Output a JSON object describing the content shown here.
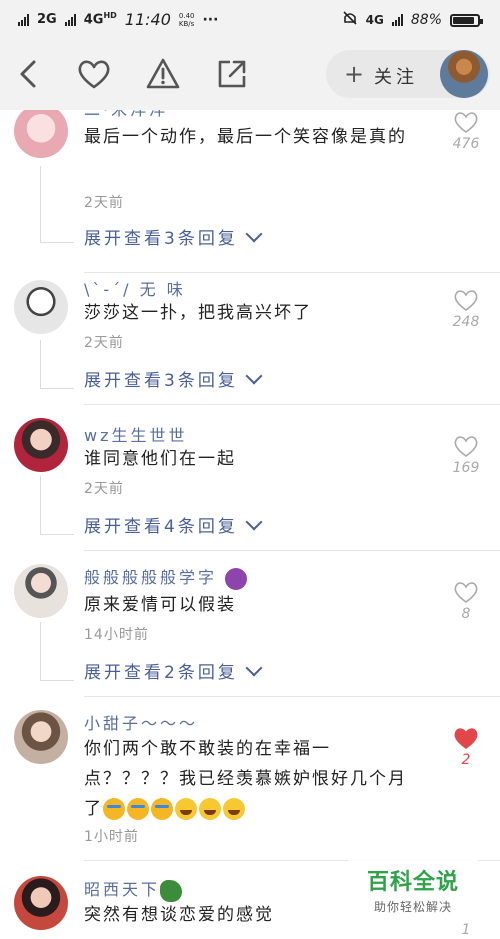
{
  "status_bar": {
    "network_1": "2G",
    "network_2": "4G",
    "network_2_sup": "HD",
    "time": "11:40",
    "speed_value": "0.40",
    "speed_unit": "KB/s",
    "more": "···",
    "right_network": "4G",
    "battery_text": "88%",
    "battery_level": 0.88
  },
  "toolbar": {
    "follow_label": "关注"
  },
  "comments": [
    {
      "name": "二·米洋洋",
      "text": "最后一个动作，最后一个笑容像是真的",
      "time": "2天前",
      "expand": "展开查看3条回复",
      "likes": "476",
      "liked": false,
      "avatar_color": "#f2c4c9"
    },
    {
      "name": "\\ˋ-´/ 无 味",
      "text": "莎莎这一扑，把我高兴坏了",
      "time": "2天前",
      "expand": "展开查看3条回复",
      "likes": "248",
      "liked": false,
      "avatar_color": "#bdbdbd"
    },
    {
      "name": "wz生生世世",
      "text": "谁同意他们在一起",
      "time": "2天前",
      "expand": "展开查看4条回复",
      "likes": "169",
      "liked": false,
      "avatar_color": "#a0253b"
    },
    {
      "name": "般般般般般学字",
      "text": "原来爱情可以假装",
      "time": "14小时前",
      "expand": "展开查看2条回复",
      "likes": "8",
      "liked": false,
      "avatar_color": "#d9d3cf"
    },
    {
      "name": "小甜子～～～",
      "text": "你们两个敢不敢装的在幸福一点？？？？我已经羡慕嫉妒恨好几个月了",
      "time": "1小时前",
      "expand": "",
      "likes": "2",
      "liked": true,
      "avatar_color": "#8c7a6b"
    },
    {
      "name": "昭西天下",
      "text": "突然有想谈恋爱的感觉",
      "time": "",
      "expand": "",
      "likes": "1",
      "liked": false,
      "avatar_color": "#6b4a3c"
    }
  ],
  "watermark": {
    "title": "百科全说",
    "subtitle": "助你轻松解决"
  },
  "colors": {
    "username": "#5a6e9e",
    "expand_link": "#4a5f95",
    "liked_heart": "#e2464b",
    "toolbar_bg": "#f2f2f2",
    "brand_green": "#2fa24a"
  }
}
